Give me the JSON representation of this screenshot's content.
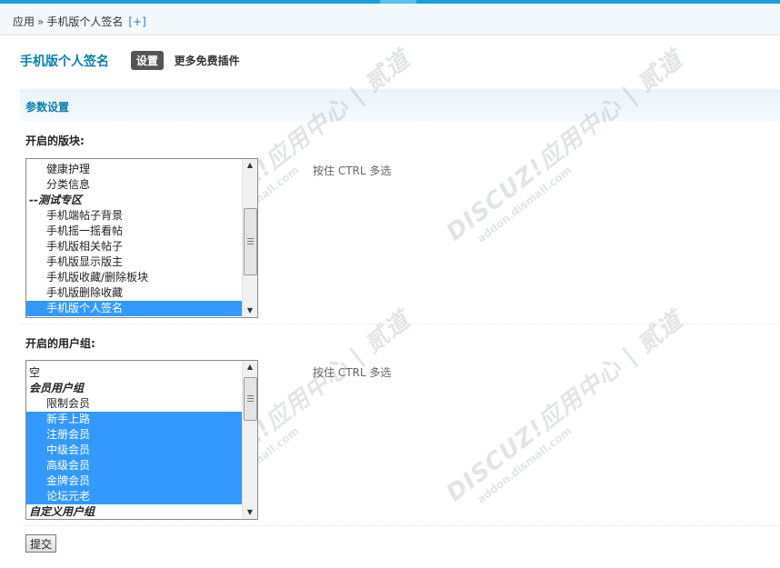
{
  "breadcrumb": {
    "root": "应用",
    "separator": "»",
    "current": "手机版个人签名",
    "plus": "[+]"
  },
  "header": {
    "title": "手机版个人签名",
    "active_tab": "设置",
    "more_link": "更多免费插件"
  },
  "section": {
    "title": "参数设置"
  },
  "forums_field": {
    "label": "开启的版块:",
    "hint": "按住 CTRL 多选",
    "options": [
      {
        "label": "健康护理",
        "type": "item",
        "selected": false
      },
      {
        "label": "分类信息",
        "type": "item",
        "selected": false
      },
      {
        "label": "--测试专区",
        "type": "group",
        "selected": false
      },
      {
        "label": "手机端帖子背景",
        "type": "item",
        "selected": false
      },
      {
        "label": "手机摇一摇看帖",
        "type": "item",
        "selected": false
      },
      {
        "label": "手机版相关帖子",
        "type": "item",
        "selected": false
      },
      {
        "label": "手机版显示版主",
        "type": "item",
        "selected": false
      },
      {
        "label": "手机版收藏/删除板块",
        "type": "item",
        "selected": false
      },
      {
        "label": "手机版删除收藏",
        "type": "item",
        "selected": false
      },
      {
        "label": "手机版个人签名",
        "type": "item",
        "selected": true
      }
    ]
  },
  "groups_field": {
    "label": "开启的用户组:",
    "hint": "按住 CTRL 多选",
    "options": [
      {
        "label": "空",
        "type": "plain",
        "selected": false
      },
      {
        "label": "会员用户组",
        "type": "group",
        "selected": false
      },
      {
        "label": "限制会员",
        "type": "item",
        "selected": false
      },
      {
        "label": "新手上路",
        "type": "item",
        "selected": true
      },
      {
        "label": "注册会员",
        "type": "item",
        "selected": true
      },
      {
        "label": "中级会员",
        "type": "item",
        "selected": true
      },
      {
        "label": "高级会员",
        "type": "item",
        "selected": true
      },
      {
        "label": "金牌会员",
        "type": "item",
        "selected": true
      },
      {
        "label": "论坛元老",
        "type": "item",
        "selected": true
      },
      {
        "label": "自定义用户组",
        "type": "group",
        "selected": false
      }
    ]
  },
  "submit_label": "提交",
  "watermark": {
    "brand": "DISCUZ!应用中心 | 贰道",
    "url": "addon.dismall.com"
  },
  "colors": {
    "accent": "#0c7fae",
    "selection": "#3399ff",
    "topbar": "#1a9fd9"
  }
}
